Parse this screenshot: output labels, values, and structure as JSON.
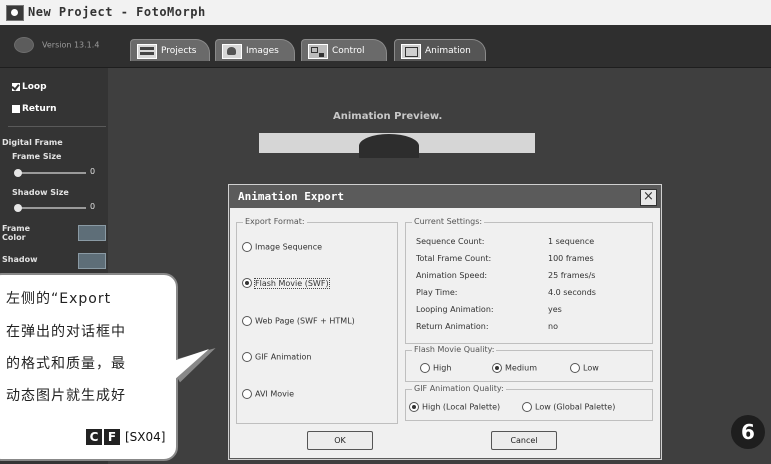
{
  "window": {
    "title": "New Project - FotoMorph"
  },
  "app": {
    "version": "Version 13.1.4"
  },
  "tabs": [
    {
      "label": "Projects",
      "icon": "grid-icon"
    },
    {
      "label": "Images",
      "icon": "image-icon"
    },
    {
      "label": "Control",
      "icon": "control-icon"
    },
    {
      "label": "Animation",
      "icon": "animation-icon",
      "active": true
    }
  ],
  "sidebar": {
    "loop_label": "Loop",
    "loop_checked": true,
    "return_label": "Return",
    "return_checked": false,
    "digital_frame": "Digital Frame",
    "frame_size": "Frame Size",
    "frame_size_value": "0",
    "shadow_size": "Shadow Size",
    "shadow_size_value": "0",
    "frame_color": "Frame Color",
    "shadow": "Shadow"
  },
  "preview": {
    "title": "Animation Preview."
  },
  "dialog": {
    "title": "Animation Export",
    "export_format": {
      "label": "Export Format:",
      "options": [
        "Image Sequence",
        "Flash Movie (SWF)",
        "Web Page (SWF + HTML)",
        "GIF Animation",
        "AVI Movie"
      ],
      "selected": "Flash Movie (SWF)"
    },
    "current_settings": {
      "label": "Current Settings:",
      "rows": [
        {
          "key": "Sequence Count:",
          "value": "1 sequence"
        },
        {
          "key": "Total Frame Count:",
          "value": "100 frames"
        },
        {
          "key": "Animation Speed:",
          "value": "25 frames/s"
        },
        {
          "key": "Play Time:",
          "value": "4.0 seconds"
        },
        {
          "key": "Looping Animation:",
          "value": "yes"
        },
        {
          "key": "Return Animation:",
          "value": "no"
        }
      ]
    },
    "flash_quality": {
      "label": "Flash Movie Quality:",
      "options": [
        "High",
        "Medium",
        "Low"
      ],
      "selected": "Medium"
    },
    "gif_quality": {
      "label": "GIF Animation Quality:",
      "options": [
        "High (Local Palette)",
        "Low (Global Palette)"
      ],
      "selected": "High (Local Palette)"
    },
    "ok_label": "OK",
    "cancel_label": "Cancel"
  },
  "callout": {
    "lines": [
      "左侧的“Export",
      "在弹出的对话框中",
      "的格式和质量，最",
      "动态图片就生成好"
    ],
    "badge_c": "C",
    "badge_f": "F",
    "code": "[SX04]"
  },
  "step_number": "6"
}
